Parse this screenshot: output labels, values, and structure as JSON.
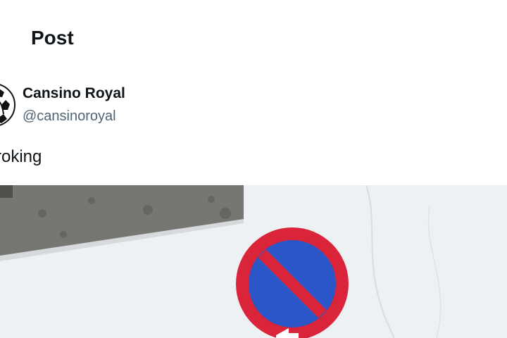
{
  "header": {
    "title": "Post"
  },
  "author": {
    "display_name": "Cansino Royal",
    "handle": "@cansinoroyal",
    "avatar_icon": "soccer-ball-avatar"
  },
  "post": {
    "text": "roking"
  },
  "media": {
    "description_icon": "no-parking-sign-icon",
    "colors": {
      "wall": "#eef1f3",
      "stone": "#6d6d6a",
      "sign_red": "#d9243a",
      "sign_blue": "#2b56c7"
    }
  }
}
